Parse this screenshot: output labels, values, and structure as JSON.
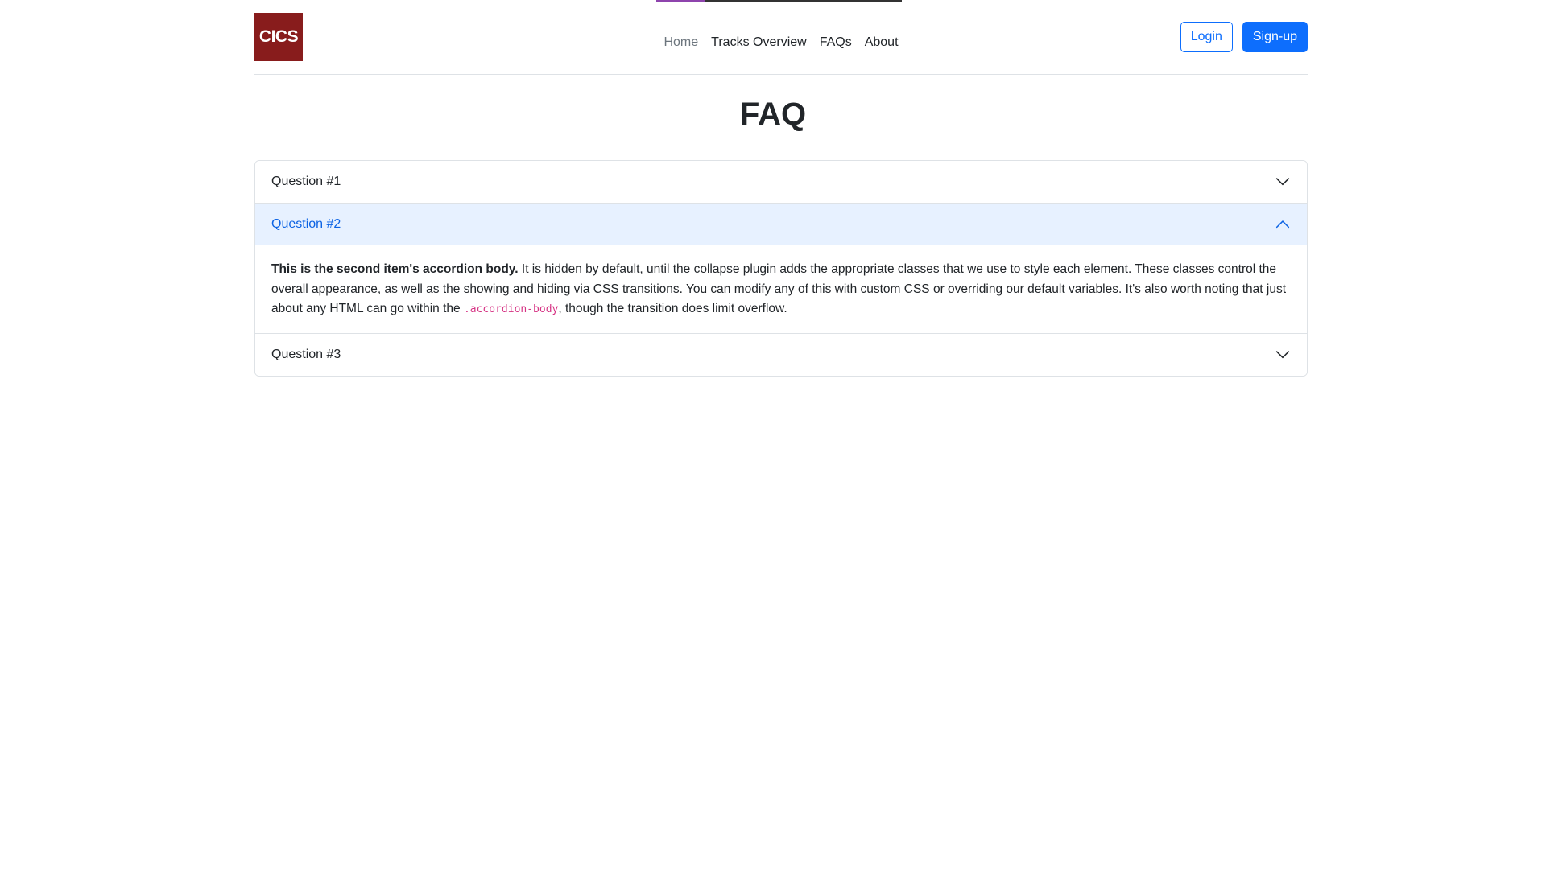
{
  "header": {
    "logo_text": "CICS",
    "nav": [
      {
        "label": "Home"
      },
      {
        "label": "Tracks Overview"
      },
      {
        "label": "FAQs"
      },
      {
        "label": "About"
      }
    ],
    "login_label": "Login",
    "signup_label": "Sign-up"
  },
  "page": {
    "title": "FAQ"
  },
  "accordion": {
    "items": [
      {
        "question": "Question #1",
        "expanded": false
      },
      {
        "question": "Question #2",
        "expanded": true,
        "body_strong": "This is the second item's accordion body.",
        "body_text": " It is hidden by default, until the collapse plugin adds the appropriate classes that we use to style each element. These classes control the overall appearance, as well as the showing and hiding via CSS transitions. You can modify any of this with custom CSS or overriding our default variables. It's also worth noting that just about any HTML can go within the ",
        "body_code": ".accordion-body",
        "body_tail": ", though the transition does limit overflow."
      },
      {
        "question": "Question #3",
        "expanded": false
      }
    ]
  },
  "colors": {
    "logo_bg": "#881c1c",
    "primary": "#0d6efd",
    "accordion_active_bg": "#e7f1ff",
    "accordion_active_text": "#0c63e4",
    "code": "#d63384"
  },
  "icons": {
    "collapsed": "chevron-down-icon",
    "expanded": "chevron-up-icon"
  }
}
